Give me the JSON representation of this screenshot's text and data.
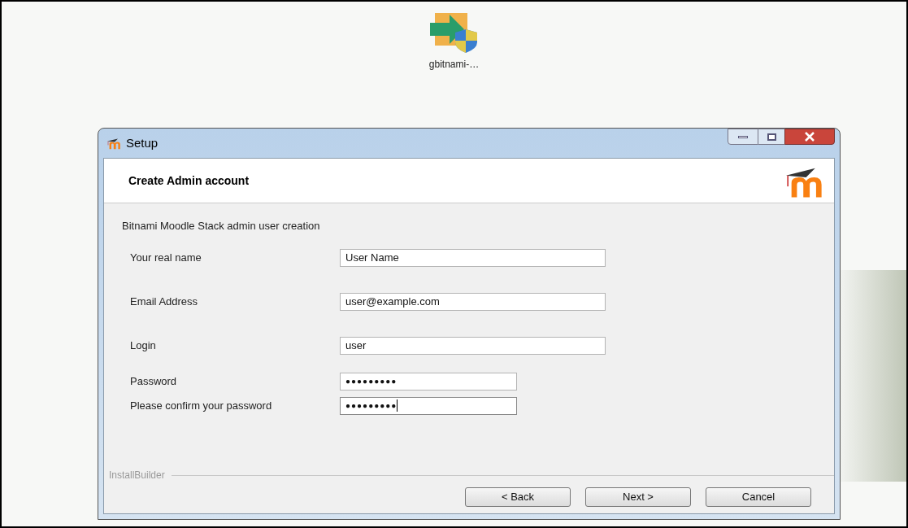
{
  "desktop_icon": {
    "label": "gbitnami-…"
  },
  "window": {
    "title": "Setup"
  },
  "header": {
    "title": "Create Admin account"
  },
  "section_label": "Bitnami Moodle Stack admin user creation",
  "fields": [
    {
      "kind": "wide",
      "label": "Your real name",
      "value": "User Name",
      "focused": false
    },
    {
      "kind": "wide",
      "label": "Email Address",
      "value": "user@example.com",
      "focused": false
    },
    {
      "kind": "wide",
      "label": "Login",
      "value": "user",
      "focused": false
    },
    {
      "kind": "short",
      "label": "Password",
      "value": "●●●●●●●●●",
      "focused": false
    },
    {
      "kind": "short",
      "label": "Please confirm your password",
      "value": "●●●●●●●●●",
      "focused": true
    }
  ],
  "footer": {
    "brand": "InstallBuilder"
  },
  "buttons": [
    "< Back",
    "Next >",
    "Cancel"
  ]
}
